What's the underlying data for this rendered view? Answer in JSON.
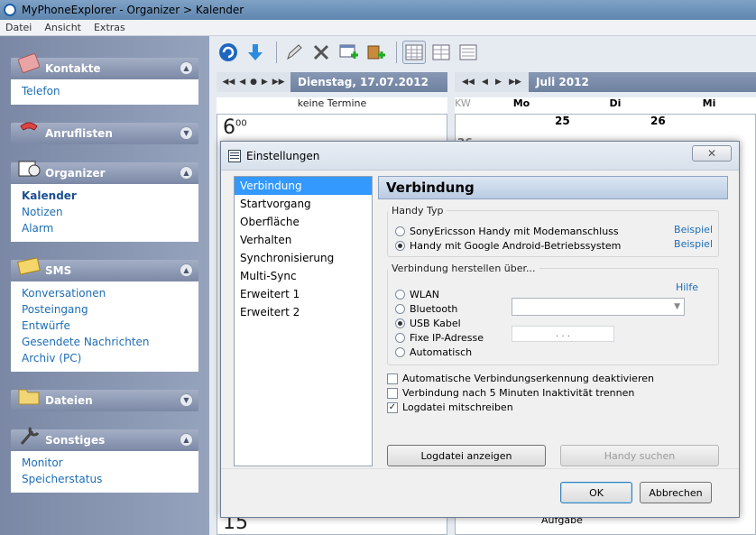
{
  "window": {
    "title": "MyPhoneExplorer -  Organizer > Kalender"
  },
  "menu": [
    "Datei",
    "Ansicht",
    "Extras"
  ],
  "sidebar": {
    "kontakte": {
      "title": "Kontakte",
      "items": [
        "Telefon"
      ]
    },
    "anruflisten": {
      "title": "Anruflisten"
    },
    "organizer": {
      "title": "Organizer",
      "items": [
        "Kalender",
        "Notizen",
        "Alarm"
      ]
    },
    "sms": {
      "title": "SMS",
      "items": [
        "Konversationen",
        "Posteingang",
        "Entwürfe",
        "Gesendete Nachrichten",
        "Archiv (PC)"
      ]
    },
    "dateien": {
      "title": "Dateien"
    },
    "sonstiges": {
      "title": "Sonstiges",
      "items": [
        "Monitor",
        "Speicherstatus"
      ]
    }
  },
  "calendar": {
    "day_title": "Dienstag, 17.07.2012",
    "month_title": "Juli 2012",
    "keine_termine": "keine Termine",
    "kw_label": "KW",
    "weekdays": [
      "Mo",
      "Di",
      "Mi"
    ],
    "day_numbers": [
      "25",
      "26"
    ],
    "hours": [
      {
        "h": "6",
        "m": "00"
      },
      {
        "h": "15",
        "m": ""
      }
    ],
    "week_number": "26",
    "aufgabe": "Aufgabe"
  },
  "dialog": {
    "title": "Einstellungen",
    "categories": [
      "Verbindung",
      "Startvorgang",
      "Oberfläche",
      "Verhalten",
      "Synchronisierung",
      "Multi-Sync",
      "Erweitert 1",
      "Erweitert 2"
    ],
    "panel_title": "Verbindung",
    "handy_typ": {
      "legend": "Handy Typ",
      "options": [
        {
          "label": "SonyEricsson Handy mit Modemanschluss",
          "link": "Beispiel",
          "selected": false
        },
        {
          "label": "Handy mit Google Android-Betriebssystem",
          "link": "Beispiel",
          "selected": true
        }
      ]
    },
    "verbindung": {
      "legend": "Verbindung herstellen über...",
      "help_link": "Hilfe",
      "options": [
        {
          "label": "WLAN",
          "selected": false
        },
        {
          "label": "Bluetooth",
          "selected": false
        },
        {
          "label": "USB Kabel",
          "selected": true
        },
        {
          "label": "Fixe IP-Adresse",
          "selected": false
        },
        {
          "label": "Automatisch",
          "selected": false
        }
      ],
      "ip_placeholder": ". . ."
    },
    "checkboxes": [
      {
        "label": "Automatische Verbindungserkennung deaktivieren",
        "checked": false
      },
      {
        "label": "Verbindung nach 5 Minuten Inaktivität trennen",
        "checked": false
      },
      {
        "label": "Logdatei mitschreiben",
        "checked": true
      }
    ],
    "buttons": {
      "log": "Logdatei anzeigen",
      "search": "Handy suchen",
      "ok": "OK",
      "cancel": "Abbrechen"
    }
  },
  "colors": {
    "accent": "#3399ff",
    "link": "#1d6db5",
    "panel_head": "#7c89a6"
  }
}
